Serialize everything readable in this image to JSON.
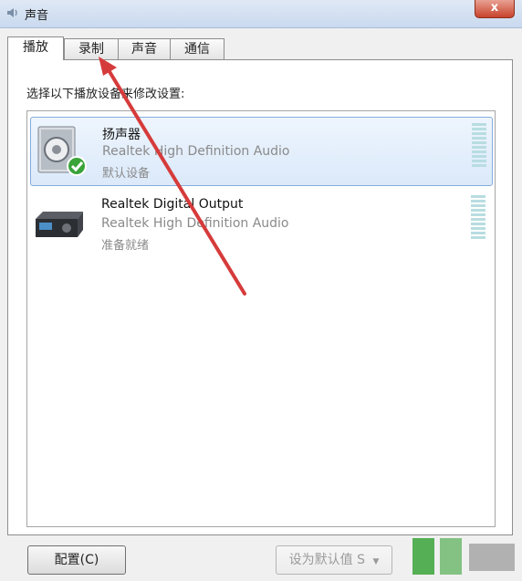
{
  "window": {
    "title": "声音",
    "close_label": "x"
  },
  "tabs": [
    {
      "label": "播放",
      "active": true
    },
    {
      "label": "录制",
      "active": false
    },
    {
      "label": "声音",
      "active": false
    },
    {
      "label": "通信",
      "active": false
    }
  ],
  "instruction": "选择以下播放设备来修改设置:",
  "devices": [
    {
      "name": "扬声器",
      "description": "Realtek High Definition Audio",
      "status": "默认设备",
      "icon": "speaker-icon",
      "selected": true,
      "default": true
    },
    {
      "name": "Realtek Digital Output",
      "description": "Realtek High Definition Audio",
      "status": "准备就绪",
      "icon": "digital-output-icon",
      "selected": false,
      "default": false
    }
  ],
  "buttons": {
    "configure": "配置(C)",
    "set_default": "设为默认值",
    "set_default_suffix": "S",
    "dropdown": "▼"
  },
  "annotation": {
    "color": "#d63b3b"
  }
}
